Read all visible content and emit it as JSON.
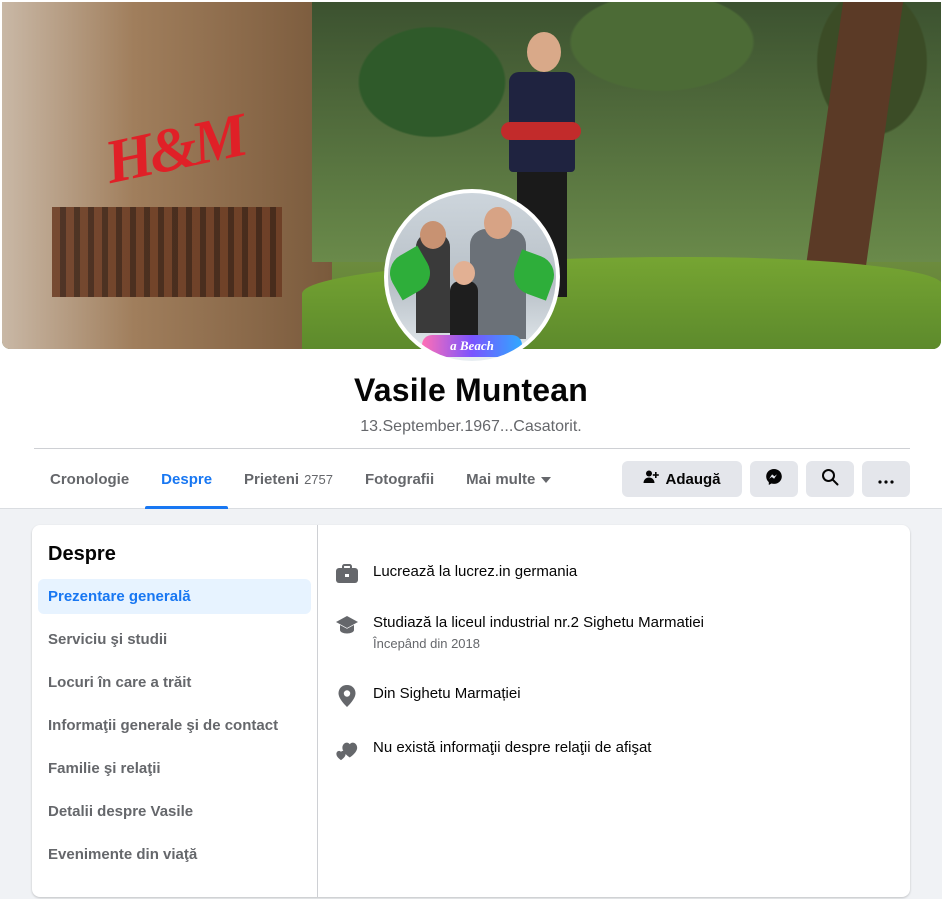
{
  "profile": {
    "name": "Vasile Muntean",
    "bio": "13.September.1967...Casatorit.",
    "avatar_banner": "a Beach"
  },
  "cover": {
    "store_sign": "H&M"
  },
  "tabs": [
    {
      "label": "Cronologie",
      "count": ""
    },
    {
      "label": "Despre",
      "count": ""
    },
    {
      "label": "Prieteni",
      "count": "2757"
    },
    {
      "label": "Fotografii",
      "count": ""
    },
    {
      "label": "Mai multe",
      "count": ""
    }
  ],
  "actions": {
    "add_label": "Adaugă",
    "messenger_icon": "messenger-icon",
    "search_icon": "search-icon",
    "more_icon": "more-dots-icon"
  },
  "about": {
    "title": "Despre",
    "menu": [
      "Prezentare generală",
      "Serviciu şi studii",
      "Locuri în care a trăit",
      "Informaţii generale şi de contact",
      "Familie şi relaţii",
      "Detalii despre Vasile",
      "Evenimente din viaţă"
    ],
    "items": [
      {
        "icon": "briefcase-icon",
        "text": "Lucrează la lucrez.in germania",
        "sub": ""
      },
      {
        "icon": "graduation-cap-icon",
        "text": "Studiază la liceul industrial nr.2 Sighetu Marmatiei",
        "sub": "Începând din 2018"
      },
      {
        "icon": "location-pin-icon",
        "text": "Din Sighetu Marmației",
        "sub": ""
      },
      {
        "icon": "hearts-icon",
        "text": "Nu există informaţii despre relaţii de afişat",
        "sub": ""
      }
    ]
  },
  "colors": {
    "accent": "#1877f2",
    "secondary_text": "#65676b",
    "button_bg": "#e4e6eb",
    "page_bg": "#f0f2f5"
  }
}
